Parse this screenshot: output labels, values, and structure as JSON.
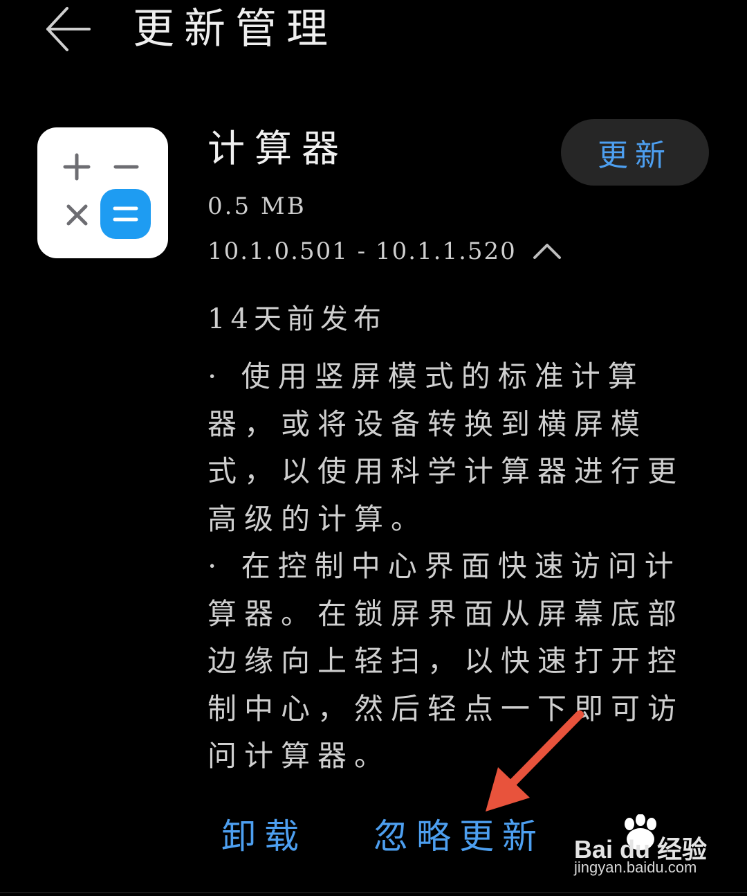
{
  "header": {
    "back_icon": "arrow-left-icon",
    "title": "更新管理"
  },
  "app": {
    "icon": "calculator-app-icon",
    "name": "计算器",
    "size": "0.5 MB",
    "version_range": "10.1.0.501 - 10.1.1.520",
    "collapse_icon": "chevron-up-icon",
    "update_label": "更新"
  },
  "release": {
    "date": "14天前发布",
    "notes": [
      "· 使用竖屏模式的标准计算器，或将设备转换到横屏模式，以使用科学计算器进行更高级的计算。",
      "· 在控制中心界面快速访问计算器。在锁屏界面从屏幕底部边缘向上轻扫，以快速打开控制中心，然后轻点一下即可访问计算器。"
    ]
  },
  "actions": {
    "uninstall_label": "卸载",
    "ignore_update_label": "忽略更新"
  },
  "watermark": {
    "brand": "Bai du 经验",
    "url": "jingyan.baidu.com"
  },
  "colors": {
    "background": "#000000",
    "accent": "#4d9ff0",
    "button_bg": "#262626",
    "annotation_arrow": "#e8533c"
  }
}
